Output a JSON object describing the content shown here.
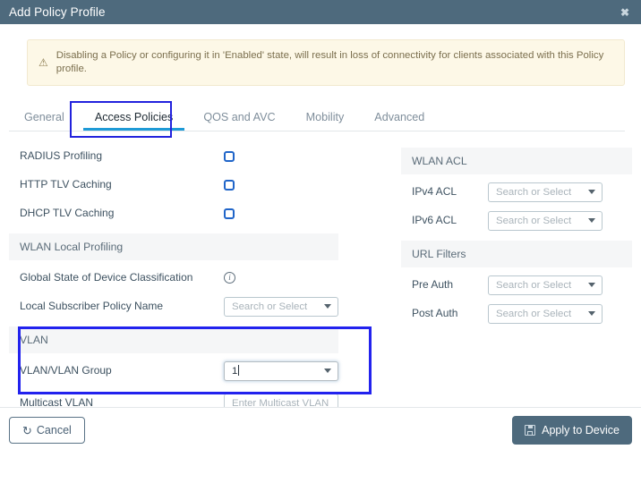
{
  "titlebar": {
    "title": "Add Policy Profile",
    "close_icon": "close-icon",
    "close_glyph": "✖",
    "bg_color": "#4e6a7d"
  },
  "warning": {
    "icon": "warning-triangle-icon",
    "icon_glyph": "⚠",
    "text": "Disabling a Policy or configuring it in 'Enabled' state, will result in loss of connectivity for clients associated with this Policy profile.",
    "bg_color": "#fdf8e7",
    "text_color": "#7b6f4e"
  },
  "tabs": {
    "items": [
      {
        "label": "General",
        "active": false
      },
      {
        "label": "Access Policies",
        "active": true
      },
      {
        "label": "QOS and AVC",
        "active": false
      },
      {
        "label": "Mobility",
        "active": false
      },
      {
        "label": "Advanced",
        "active": false
      }
    ],
    "active_underline_color": "#1e9ad6",
    "annotation_color": "#2222dd"
  },
  "left_column": {
    "checkbox_rows": [
      {
        "label": "RADIUS Profiling",
        "checked": false
      },
      {
        "label": "HTTP TLV Caching",
        "checked": false
      },
      {
        "label": "DHCP TLV Caching",
        "checked": false
      }
    ],
    "wlan_local_profiling": {
      "section_title": "WLAN Local Profiling",
      "global_state": {
        "label": "Global State of Device Classification",
        "icon": "info-icon",
        "icon_glyph": "i"
      },
      "local_subscriber_policy": {
        "label": "Local Subscriber Policy Name",
        "placeholder": "Search or Select",
        "value": ""
      }
    },
    "vlan": {
      "section_title": "VLAN",
      "vlan_group": {
        "label": "VLAN/VLAN Group",
        "value": "1",
        "focused": true
      },
      "multicast_vlan": {
        "label": "Multicast VLAN",
        "placeholder": "Enter Multicast VLAN",
        "value": ""
      },
      "annotation_color": "#2222ee"
    }
  },
  "right_column": {
    "wlan_acl": {
      "section_title": "WLAN ACL",
      "fields": [
        {
          "label": "IPv4 ACL",
          "placeholder": "Search or Select",
          "value": ""
        },
        {
          "label": "IPv6 ACL",
          "placeholder": "Search or Select",
          "value": ""
        }
      ]
    },
    "url_filters": {
      "section_title": "URL Filters",
      "fields": [
        {
          "label": "Pre Auth",
          "placeholder": "Search or Select",
          "value": ""
        },
        {
          "label": "Post Auth",
          "placeholder": "Search or Select",
          "value": ""
        }
      ]
    }
  },
  "footer": {
    "cancel": {
      "label": "Cancel",
      "icon": "undo-arrow-icon",
      "icon_glyph": "↺"
    },
    "apply": {
      "label": "Apply to Device",
      "icon": "save-disk-icon",
      "bg_color": "#4e6a7d"
    }
  }
}
